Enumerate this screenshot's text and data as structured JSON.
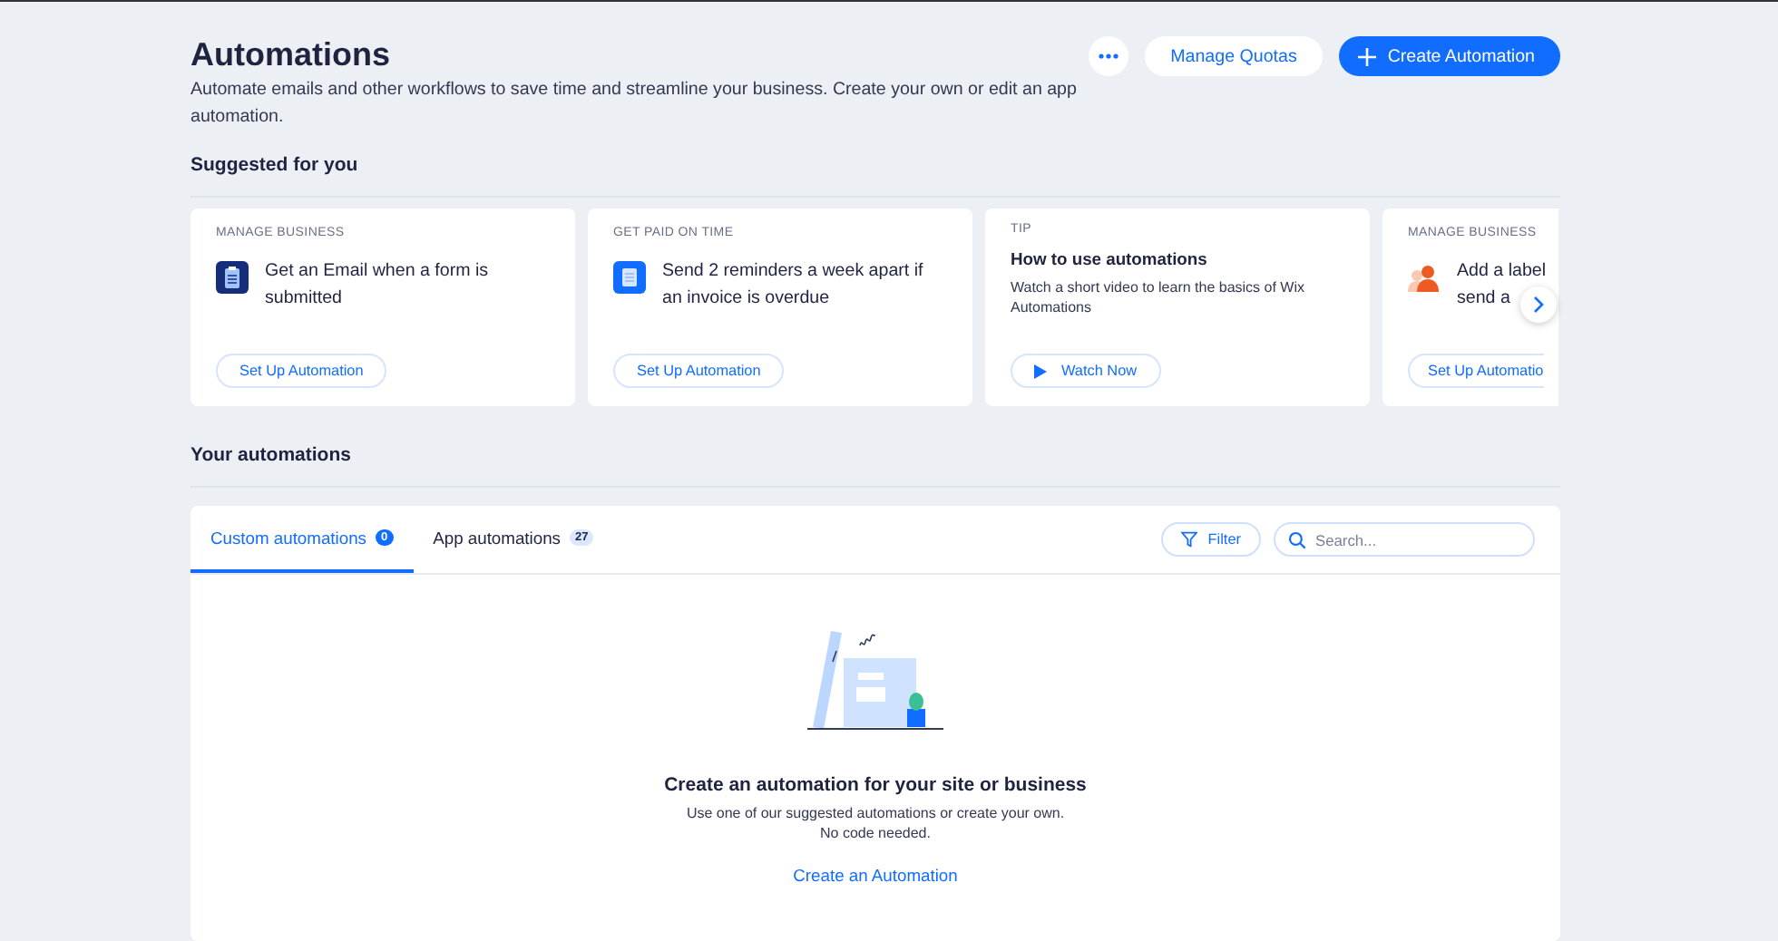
{
  "header": {
    "title": "Automations",
    "description": "Automate emails and other workflows to save time and streamline your business. Create your own or edit an app automation.",
    "manage_button": "Manage Quotas",
    "create_button": "Create Automation"
  },
  "suggested": {
    "title": "Suggested for you",
    "cards": [
      {
        "kind": "task",
        "category": "MANAGE BUSINESS",
        "title": "Get an Email when a form is submitted",
        "button": "Set Up Automation"
      },
      {
        "kind": "task",
        "category": "GET PAID ON TIME",
        "title": "Send 2 reminders a week apart if an invoice is overdue",
        "button": "Set Up Automation"
      },
      {
        "kind": "tip",
        "category": "TIP",
        "title": "How to use automations",
        "description": "Watch a short video to learn the basics of Wix Automations",
        "button": "Watch Now"
      },
      {
        "kind": "task",
        "category": "MANAGE BUSINESS",
        "title": "Add a label\nsend a",
        "button": "Set Up Automatio"
      }
    ]
  },
  "yours": {
    "title": "Your automations",
    "tabs": [
      {
        "label": "Custom automations",
        "count": "0",
        "selected": true
      },
      {
        "label": "App automations",
        "count": "27",
        "selected": false
      }
    ],
    "filter": "Filter",
    "search": {
      "placeholder": "Search..."
    },
    "empty": {
      "title": "Create an automation for your site or business",
      "text": "Use one of our suggested automations or create your own.\nNo code needed.",
      "link": "Create an Automation"
    }
  }
}
